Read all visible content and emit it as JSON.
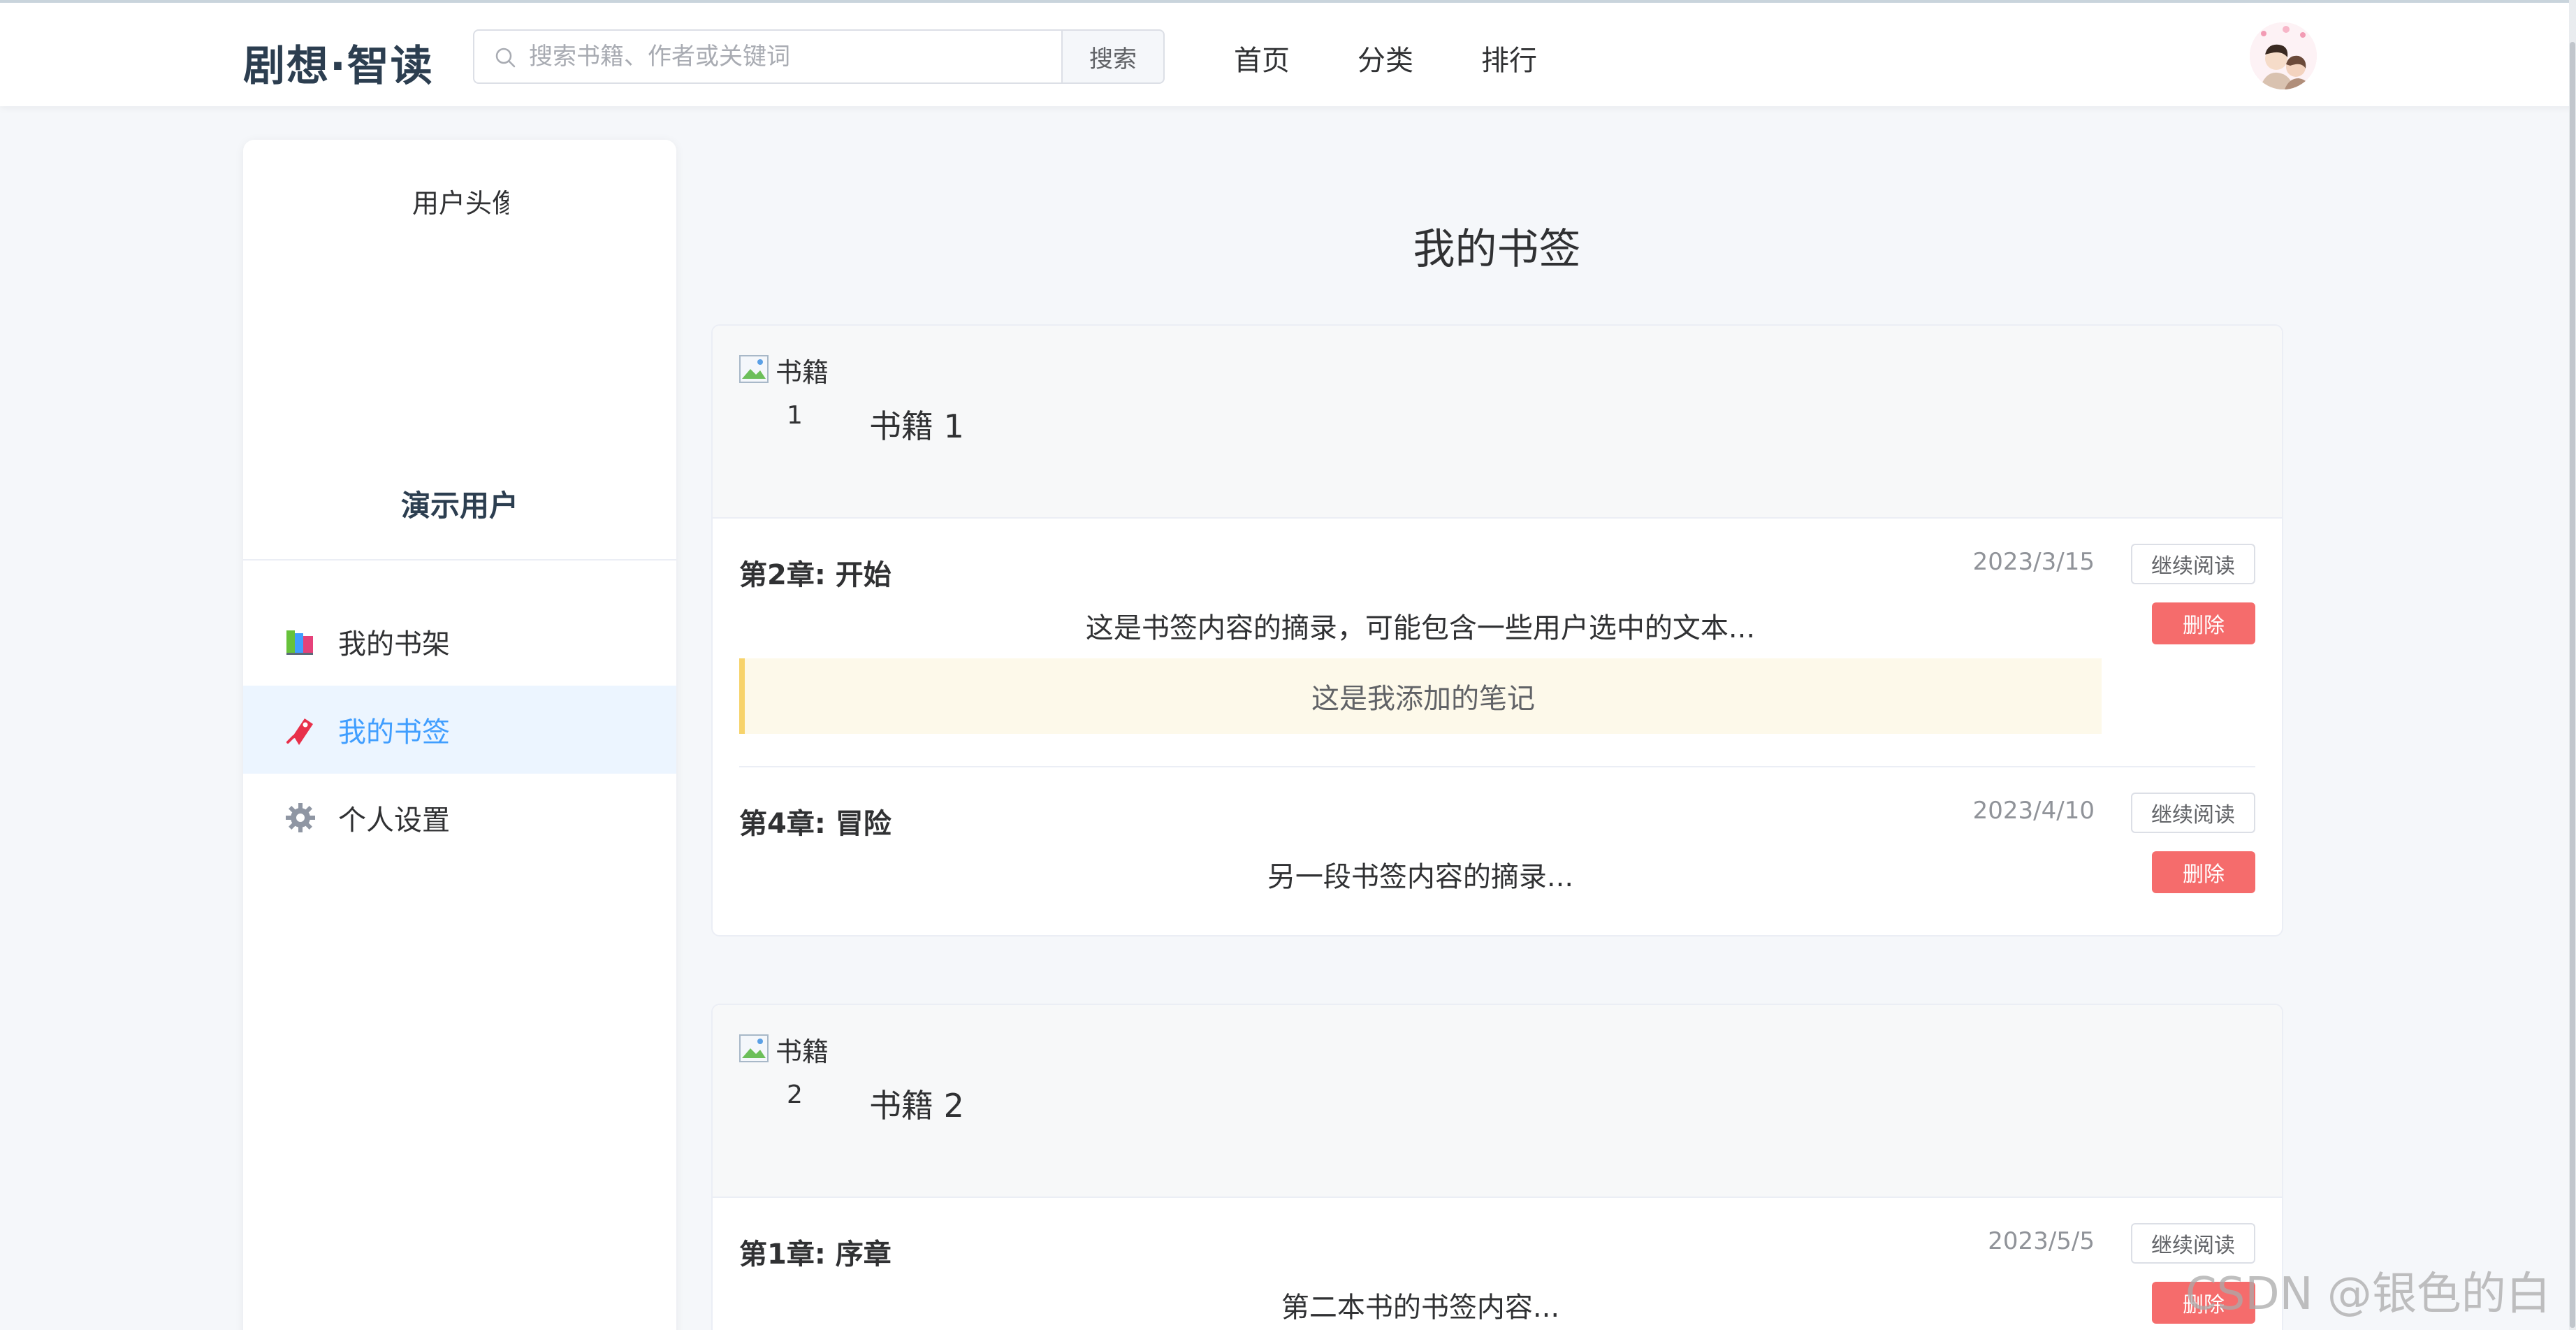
{
  "header": {
    "logo": "剧想·智读",
    "search_placeholder": "搜索书籍、作者或关键词",
    "search_button": "搜索",
    "nav": [
      "首页",
      "分类",
      "排行"
    ]
  },
  "sidebar": {
    "avatar_alt": "用户头像",
    "user_name": "演示用户",
    "menu": [
      {
        "label": "我的书架",
        "icon": "books-icon"
      },
      {
        "label": "我的书签",
        "icon": "bookmark-icon",
        "active": true
      },
      {
        "label": "个人设置",
        "icon": "gear-icon"
      }
    ]
  },
  "main": {
    "title": "我的书签",
    "books": [
      {
        "cover_alt": "书籍",
        "cover_num": "1",
        "title": "书籍 1",
        "bookmarks": [
          {
            "chapter": "第2章: 开始",
            "date": "2023/3/15",
            "excerpt": "这是书签内容的摘录，可能包含一些用户选中的文本...",
            "note": "这是我添加的笔记"
          },
          {
            "chapter": "第4章: 冒险",
            "date": "2023/4/10",
            "excerpt": "另一段书签内容的摘录..."
          }
        ]
      },
      {
        "cover_alt": "书籍",
        "cover_num": "2",
        "title": "书籍 2",
        "bookmarks": [
          {
            "chapter": "第1章: 序章",
            "date": "2023/5/5",
            "excerpt": "第二本书的书签内容..."
          }
        ]
      }
    ],
    "continue_label": "继续阅读",
    "delete_label": "删除"
  },
  "watermark": "CSDN @银色的白",
  "colors": {
    "accent": "#409eff",
    "danger": "#f56c6c",
    "note_border": "#f7d36b"
  }
}
